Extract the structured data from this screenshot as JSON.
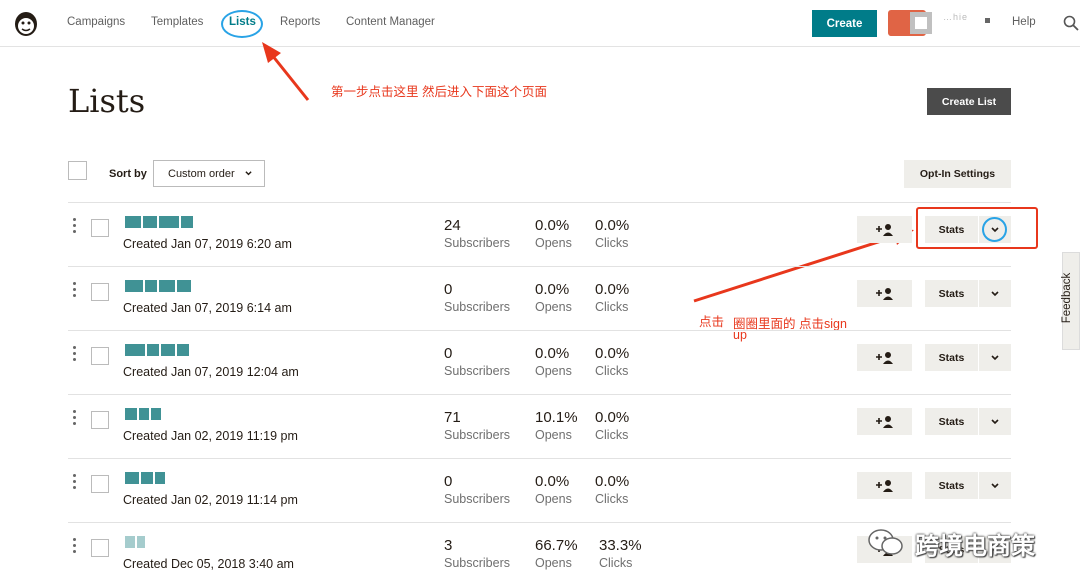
{
  "nav": {
    "items": [
      "Campaigns",
      "Templates",
      "Lists",
      "Reports",
      "Content Manager"
    ],
    "create_label": "Create",
    "account_name": "…hie",
    "help_label": "Help"
  },
  "page": {
    "title": "Lists",
    "create_list_label": "Create List",
    "sort_label": "Sort by",
    "sort_value": "Custom order",
    "optin_label": "Opt-In Settings"
  },
  "lists": [
    {
      "created": "Created Jan 07, 2019 6:20 am",
      "subscribers": "24",
      "opens": "0.0%",
      "clicks": "0.0%"
    },
    {
      "created": "Created Jan 07, 2019 6:14 am",
      "subscribers": "0",
      "opens": "0.0%",
      "clicks": "0.0%"
    },
    {
      "created": "Created Jan 07, 2019 12:04 am",
      "subscribers": "0",
      "opens": "0.0%",
      "clicks": "0.0%"
    },
    {
      "created": "Created Jan 02, 2019 11:19 pm",
      "subscribers": "71",
      "opens": "10.1%",
      "clicks": "0.0%"
    },
    {
      "created": "Created Jan 02, 2019 11:14 pm",
      "subscribers": "0",
      "opens": "0.0%",
      "clicks": "0.0%"
    },
    {
      "created": "Created Dec 05, 2018 3:40 am",
      "subscribers": "3",
      "opens": "66.7%",
      "clicks": "33.3%"
    }
  ],
  "labels": {
    "subscribers": "Subscribers",
    "opens": "Opens",
    "clicks": "Clicks",
    "stats": "Stats"
  },
  "annotations": {
    "step1": "第一步点击这里 然后进入下面这个页面",
    "click": "点击",
    "circle_note_line1": "圈圈里面的 点击sign",
    "circle_note_line2": "up"
  },
  "feedback_label": "Feedback",
  "watermark": "跨境电商策",
  "colors": {
    "accent": "#007c89",
    "annotation_red": "#e8371c",
    "annotation_blue": "#29a3e6",
    "button_gray": "#efeeea",
    "dark_button": "#4b4b4b"
  },
  "icons": [
    "mailchimp-logo-icon",
    "search-icon",
    "add-contact-icon",
    "chevron-down-icon",
    "drag-handle-icon",
    "wechat-icon"
  ]
}
